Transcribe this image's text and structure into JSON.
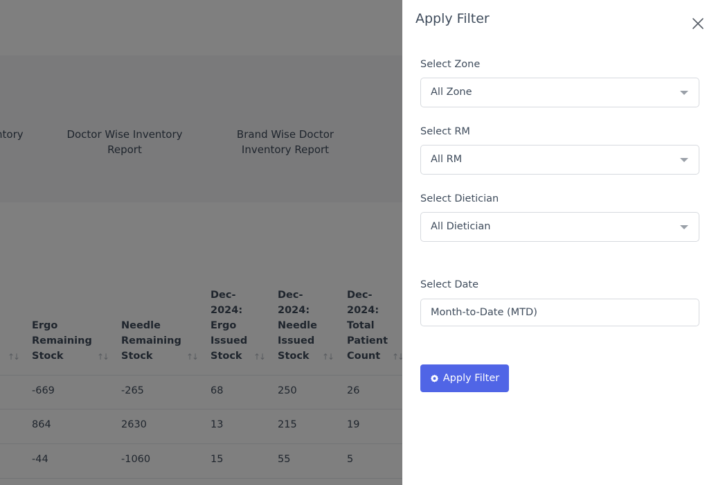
{
  "background": {
    "reports": [
      {
        "label_line1": "ntory",
        "label_line2": ""
      },
      {
        "label_line1": "Doctor Wise Inventory",
        "label_line2": "Report"
      },
      {
        "label_line1": "Brand Wise Doctor",
        "label_line2": "Inventory Report"
      }
    ],
    "table": {
      "headers": [
        [
          "Ergo",
          "Remaining",
          "Stock"
        ],
        [
          "Needle",
          "Remaining",
          "Stock"
        ],
        [
          "Dec-",
          "2024:",
          "Ergo",
          "Issued",
          "Stock"
        ],
        [
          "Dec-",
          "2024:",
          "Needle",
          "Issued",
          "Stock"
        ],
        [
          "Dec-",
          "2024:",
          "Total",
          "Patient",
          "Count"
        ]
      ],
      "sort_icon": "↑↓",
      "rows": [
        [
          "-669",
          "-265",
          "68",
          "250",
          "26"
        ],
        [
          "864",
          "2630",
          "13",
          "215",
          "19"
        ],
        [
          "-44",
          "-1060",
          "15",
          "55",
          "5"
        ]
      ]
    }
  },
  "filter_panel": {
    "title": "Apply Filter",
    "zone": {
      "label": "Select Zone",
      "value": "All Zone"
    },
    "rm": {
      "label": "Select RM",
      "value": "All RM"
    },
    "dietician": {
      "label": "Select Dietician",
      "value": "All Dietician"
    },
    "date": {
      "label": "Select Date",
      "value": "Month-to-Date (MTD)"
    },
    "apply_label": "Apply Filter",
    "accent_color": "#5065e6"
  }
}
